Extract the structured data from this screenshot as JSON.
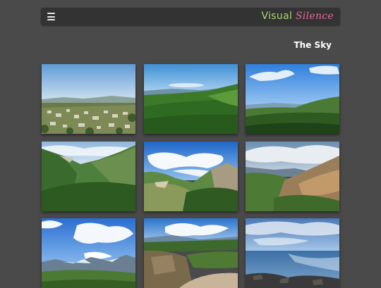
{
  "navbar": {
    "menu_icon": "hamburger-icon",
    "brand": {
      "part1": "Visual",
      "part2": "Silence",
      "part1_color": "#a8d86a",
      "part2_color": "#e6669a"
    }
  },
  "gallery": {
    "title": "The Sky",
    "photos": [
      {
        "subject": "town-valley-photo"
      },
      {
        "subject": "forest-hills-photo"
      },
      {
        "subject": "coastal-hills-photo"
      },
      {
        "subject": "mountain-ridge-photo"
      },
      {
        "subject": "cliff-valley-photo"
      },
      {
        "subject": "canyon-slope-photo"
      },
      {
        "subject": "snowy-mountains-photo"
      },
      {
        "subject": "rocky-gorge-photo"
      },
      {
        "subject": "seashore-photo"
      }
    ]
  }
}
